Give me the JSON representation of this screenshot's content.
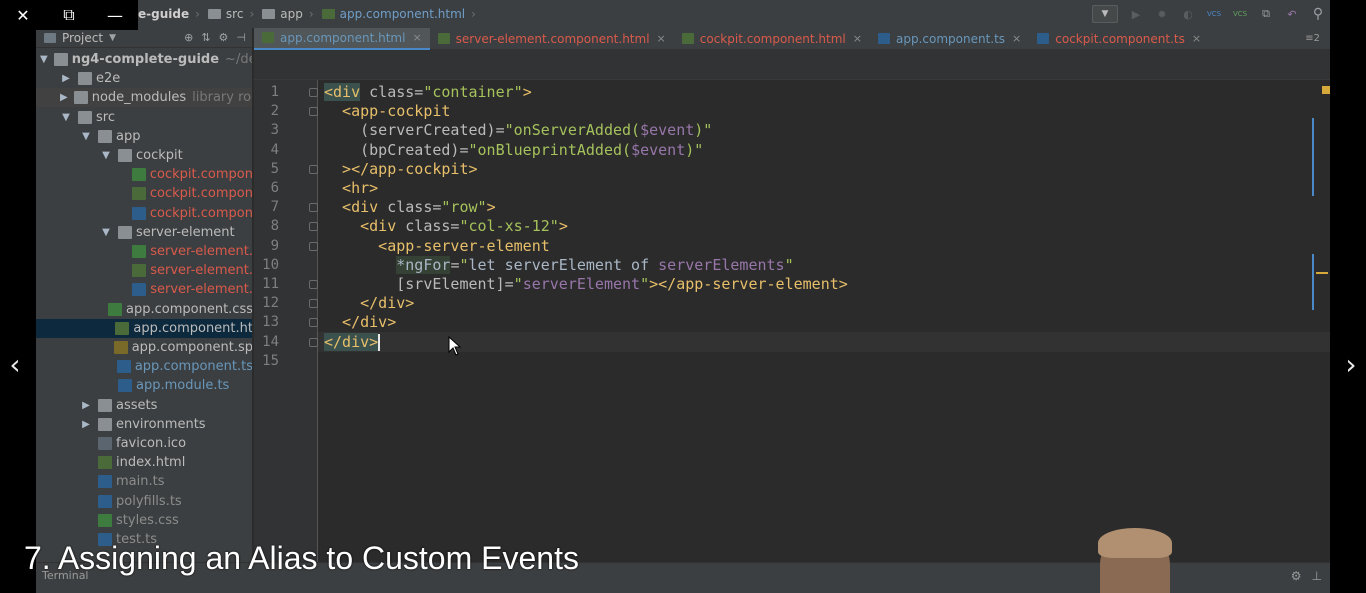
{
  "window_controls": {
    "close": "✕",
    "restore": "⧉",
    "minimize": "—"
  },
  "nav": {
    "prev": "‹",
    "next": "›"
  },
  "breadcrumb": {
    "items": [
      {
        "label": "e-guide"
      },
      {
        "label": "src"
      },
      {
        "label": "app"
      }
    ],
    "file": "app.component.html"
  },
  "toolbar_right": {
    "vcs_update": "VCS",
    "vcs_commit": "VCS"
  },
  "project_panel": {
    "header": "Project",
    "tree": [
      {
        "label": "ng4-complete-guide",
        "hint": "~/dev",
        "indent": 0,
        "arrow": "▼",
        "icon": "folder-root",
        "color": "c-bold"
      },
      {
        "label": "e2e",
        "indent": 1,
        "arrow": "▶",
        "icon": "folder",
        "color": "c-default"
      },
      {
        "label": "node_modules",
        "hint": "library roo",
        "indent": 1,
        "arrow": "▶",
        "icon": "folder",
        "color": "c-default",
        "hl": true
      },
      {
        "label": "src",
        "indent": 1,
        "arrow": "▼",
        "icon": "folder",
        "color": "c-default"
      },
      {
        "label": "app",
        "indent": 2,
        "arrow": "▼",
        "icon": "folder",
        "color": "c-default"
      },
      {
        "label": "cockpit",
        "indent": 3,
        "arrow": "▼",
        "icon": "folder",
        "color": "c-default"
      },
      {
        "label": "cockpit.compon",
        "indent": 4,
        "arrow": "",
        "icon": "fcss",
        "color": "c-red"
      },
      {
        "label": "cockpit.compon",
        "indent": 4,
        "arrow": "",
        "icon": "fhtml",
        "color": "c-red"
      },
      {
        "label": "cockpit.compon",
        "indent": 4,
        "arrow": "",
        "icon": "fts",
        "color": "c-red"
      },
      {
        "label": "server-element",
        "indent": 3,
        "arrow": "▼",
        "icon": "folder",
        "color": "c-default"
      },
      {
        "label": "server-element.",
        "indent": 4,
        "arrow": "",
        "icon": "fcss",
        "color": "c-red"
      },
      {
        "label": "server-element.",
        "indent": 4,
        "arrow": "",
        "icon": "fhtml",
        "color": "c-red"
      },
      {
        "label": "server-element.",
        "indent": 4,
        "arrow": "",
        "icon": "fts",
        "color": "c-red"
      },
      {
        "label": "app.component.css",
        "indent": 3,
        "arrow": "",
        "icon": "fcss",
        "color": "c-default"
      },
      {
        "label": "app.component.ht",
        "indent": 3,
        "arrow": "",
        "icon": "fhtml",
        "color": "c-default",
        "sel": true
      },
      {
        "label": "app.component.sp",
        "indent": 3,
        "arrow": "",
        "icon": "fspec",
        "color": "c-default"
      },
      {
        "label": "app.component.ts",
        "indent": 3,
        "arrow": "",
        "icon": "fts",
        "color": "c-blue"
      },
      {
        "label": "app.module.ts",
        "indent": 3,
        "arrow": "",
        "icon": "fts",
        "color": "c-blue"
      },
      {
        "label": "assets",
        "indent": 2,
        "arrow": "▶",
        "icon": "folder",
        "color": "c-default"
      },
      {
        "label": "environments",
        "indent": 2,
        "arrow": "▶",
        "icon": "folder",
        "color": "c-default"
      },
      {
        "label": "favicon.ico",
        "indent": 2,
        "arrow": "",
        "icon": "ficon-ico",
        "color": "c-default"
      },
      {
        "label": "index.html",
        "indent": 2,
        "arrow": "",
        "icon": "fhtml",
        "color": "c-default"
      },
      {
        "label": "main.ts",
        "indent": 2,
        "arrow": "",
        "icon": "fts",
        "color": "c-gray"
      },
      {
        "label": "polyfills.ts",
        "indent": 2,
        "arrow": "",
        "icon": "fts",
        "color": "c-gray"
      },
      {
        "label": "styles.css",
        "indent": 2,
        "arrow": "",
        "icon": "fcss",
        "color": "c-gray"
      },
      {
        "label": "test.ts",
        "indent": 2,
        "arrow": "",
        "icon": "fts",
        "color": "c-gray"
      }
    ]
  },
  "tabs": [
    {
      "label": "app.component.html",
      "icon": "fhtml",
      "color": "c-blue",
      "active": true
    },
    {
      "label": "server-element.component.html",
      "icon": "fhtml",
      "color": "c-red"
    },
    {
      "label": "cockpit.component.html",
      "icon": "fhtml",
      "color": "c-red"
    },
    {
      "label": "app.component.ts",
      "icon": "fts",
      "color": "c-blue"
    },
    {
      "label": "cockpit.component.ts",
      "icon": "fts",
      "color": "c-red"
    }
  ],
  "tab_count": "≡2",
  "editor": {
    "line_numbers": [
      "1",
      "2",
      "3",
      "4",
      "5",
      "6",
      "7",
      "8",
      "9",
      "10",
      "11",
      "12",
      "13",
      "14",
      "15"
    ],
    "current_line": 14,
    "lines": [
      [
        {
          "t": "<div",
          "c": "tg tagbg"
        },
        {
          "t": " class=",
          "c": "at"
        },
        {
          "t": "\"container\"",
          "c": "st"
        },
        {
          "t": ">",
          "c": "tg"
        }
      ],
      [
        {
          "t": "  <app-cockpit",
          "c": "tg"
        }
      ],
      [
        {
          "t": "    (serverCreated)=",
          "c": "at"
        },
        {
          "t": "\"",
          "c": "st"
        },
        {
          "t": "onServerAdded(",
          "c": "st"
        },
        {
          "t": "$event",
          "c": "vr"
        },
        {
          "t": ")\"",
          "c": "st"
        }
      ],
      [
        {
          "t": "    (bpCreated)=",
          "c": "at"
        },
        {
          "t": "\"",
          "c": "st"
        },
        {
          "t": "onBlueprintAdded(",
          "c": "st"
        },
        {
          "t": "$event",
          "c": "vr"
        },
        {
          "t": ")\"",
          "c": "st"
        }
      ],
      [
        {
          "t": "  ></app-cockpit>",
          "c": "tg"
        }
      ],
      [
        {
          "t": "  <hr>",
          "c": "tg"
        }
      ],
      [
        {
          "t": "  <div",
          "c": "tg"
        },
        {
          "t": " class=",
          "c": "at"
        },
        {
          "t": "\"row\"",
          "c": "st"
        },
        {
          "t": ">",
          "c": "tg"
        }
      ],
      [
        {
          "t": "    <div",
          "c": "tg"
        },
        {
          "t": " class=",
          "c": "at"
        },
        {
          "t": "\"col-xs-12\"",
          "c": "st"
        },
        {
          "t": ">",
          "c": "tg"
        }
      ],
      [
        {
          "t": "      <app-server-element",
          "c": "tg"
        }
      ],
      [
        {
          "t": "        ",
          "c": "tx"
        },
        {
          "t": "*ngFor",
          "c": "ng"
        },
        {
          "t": "=",
          "c": "at"
        },
        {
          "t": "\"",
          "c": "st"
        },
        {
          "t": "let serverElement of ",
          "c": "tx"
        },
        {
          "t": "serverElements",
          "c": "vr"
        },
        {
          "t": "\"",
          "c": "st"
        }
      ],
      [
        {
          "t": "        [srvElement]=",
          "c": "at"
        },
        {
          "t": "\"",
          "c": "st"
        },
        {
          "t": "serverElement",
          "c": "vr"
        },
        {
          "t": "\"",
          "c": "st"
        },
        {
          "t": "></app-server-element>",
          "c": "tg"
        }
      ],
      [
        {
          "t": "    </div>",
          "c": "tg"
        }
      ],
      [
        {
          "t": "  </div>",
          "c": "tg"
        }
      ],
      [
        {
          "t": "</div>",
          "c": "tg tagbg"
        },
        {
          "t": "",
          "c": "cursor"
        }
      ],
      []
    ]
  },
  "bottom_bar": {
    "terminal": "Terminal"
  },
  "caption": "7. Assigning an Alias to Custom Events",
  "colors": {
    "accent": "#4a88c7",
    "tag": "#e8bf6a",
    "string": "#a5c25c",
    "variable": "#9876aa",
    "error_file": "#d95a4b"
  }
}
